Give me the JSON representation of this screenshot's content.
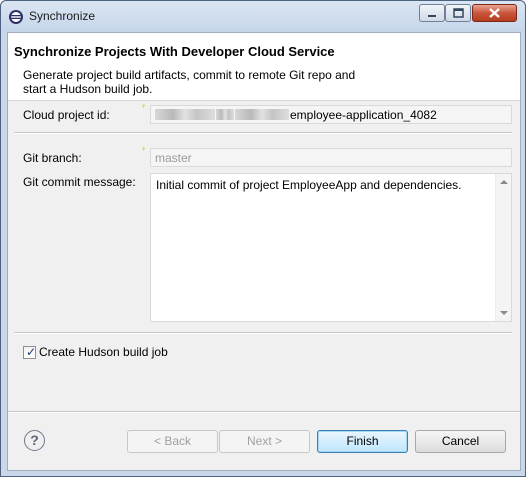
{
  "window": {
    "title": "Synchronize"
  },
  "banner": {
    "title": "Synchronize Projects With Developer Cloud Service",
    "description": "Generate project build artifacts, commit to remote Git repo and start a Hudson build job."
  },
  "form": {
    "cloud_project_id_label": "Cloud project id:",
    "cloud_project_id_value_visible": "employee-application_4082",
    "cloud_project_id_redacted_prefix": "develop... ...est...",
    "git_branch_label": "Git branch:",
    "git_branch_value": "master",
    "git_commit_message_label": "Git commit message:",
    "git_commit_message_value": "Initial commit of project EmployeeApp and dependencies.",
    "create_hudson_checkbox_label": "Create Hudson build job",
    "create_hudson_checked": true
  },
  "buttons": {
    "back": "< Back",
    "next": "Next >",
    "finish": "Finish",
    "cancel": "Cancel"
  },
  "icons": {
    "help": "help-icon",
    "app": "eclipse-icon"
  }
}
